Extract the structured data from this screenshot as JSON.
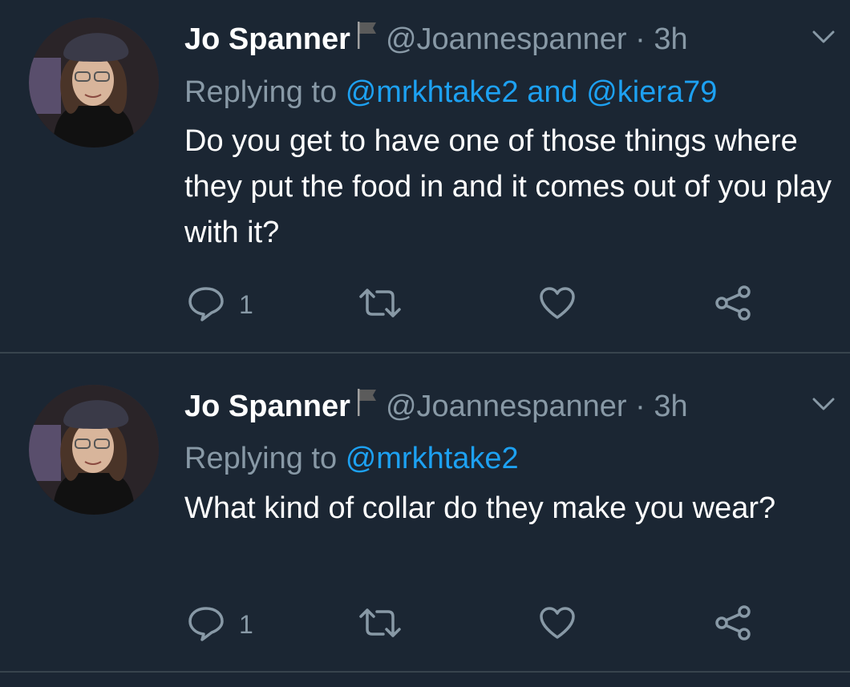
{
  "tweets": [
    {
      "author": {
        "name": "Jo Spanner",
        "handle": "@Joannespanner",
        "time": "3h"
      },
      "separator": "·",
      "replying_label": "Replying to",
      "mentions": [
        "@mrkhtake2",
        "@kiera79"
      ],
      "conjunction": "and",
      "text": "Do you get to have one of those things where they put the food in and it comes out of you play with it?",
      "reply_count": "1"
    },
    {
      "author": {
        "name": "Jo Spanner",
        "handle": "@Joannespanner",
        "time": "3h"
      },
      "separator": "·",
      "replying_label": "Replying to",
      "mentions": [
        "@mrkhtake2"
      ],
      "text": "What kind of collar do they make you wear?",
      "reply_count": "1"
    }
  ],
  "icons": {
    "reply": "speech-bubble-icon",
    "retweet": "retweet-icon",
    "like": "heart-icon",
    "share": "share-icon",
    "caret": "chevron-down-icon",
    "flag": "flag-icon"
  },
  "colors": {
    "background": "#1b2633",
    "text": "#ffffff",
    "muted": "#8899a6",
    "link": "#1da1f2",
    "divider": "#38444d"
  }
}
